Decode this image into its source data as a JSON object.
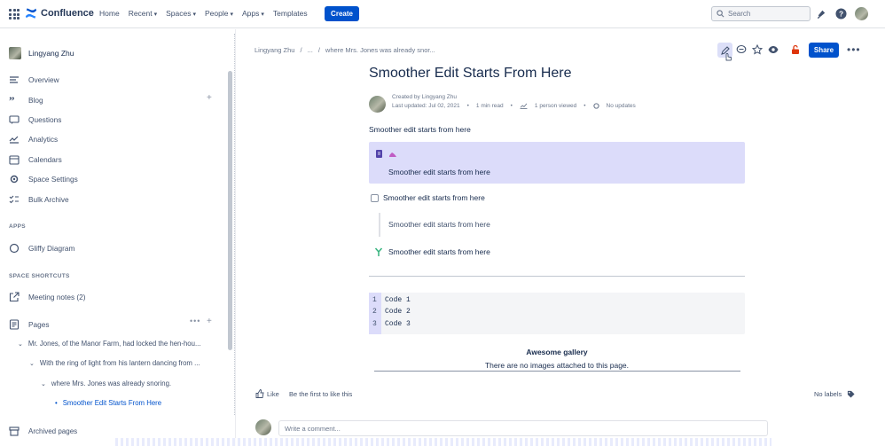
{
  "topbar": {
    "app_name": "Confluence",
    "nav": [
      "Home",
      "Recent",
      "Spaces",
      "People",
      "Apps",
      "Templates"
    ],
    "create_label": "Create",
    "search_placeholder": "Search"
  },
  "sidebar": {
    "space_name": "Lingyang Zhu",
    "items": [
      "Overview",
      "Blog",
      "Questions",
      "Analytics",
      "Calendars",
      "Space Settings",
      "Bulk Archive"
    ],
    "apps_heading": "APPS",
    "apps": [
      "Gliffy Diagram"
    ],
    "shortcuts_heading": "SPACE SHORTCUTS",
    "shortcuts": [
      "Meeting notes (2)"
    ],
    "pages_label": "Pages",
    "tree": [
      "Mr. Jones, of the Manor Farm, had locked the hen-hou...",
      "With the ring of light from his lantern dancing from ...",
      "where Mrs. Jones was already snoring.",
      "Smoother Edit Starts From Here"
    ],
    "archived_label": "Archived pages"
  },
  "breadcrumb": [
    "Lingyang Zhu",
    "/",
    "...",
    "/",
    "where Mrs. Jones was already snor..."
  ],
  "page": {
    "share_label": "Share",
    "title": "Smoother Edit Starts From Here",
    "created_by": "Created by Lingyang Zhu",
    "last_updated": "Last updated: Jul 02, 2021",
    "read_time": "1 min read",
    "viewed": "1 person viewed",
    "updates": "No updates",
    "paragraph": "Smoother edit starts from here",
    "panel_text": "Smoother edit starts from here",
    "task_text": "Smoother edit starts from here",
    "quote_text": "Smoother edit starts from here",
    "status_text": "Smoother edit starts from here",
    "code": [
      {
        "num": "1",
        "text": "Code 1"
      },
      {
        "num": "2",
        "text": "Code 2"
      },
      {
        "num": "3",
        "text": "Code 3"
      }
    ],
    "gallery_title": "Awesome gallery",
    "gallery_empty": "There are no images attached to this page."
  },
  "footer": {
    "like_label": "Like",
    "like_first": "Be the first to like this",
    "labels": "No labels",
    "comment_placeholder": "Write a comment..."
  },
  "colors": {
    "brand": "#0052cc",
    "panel": "#dcdcfa",
    "text": "#172b4d"
  }
}
